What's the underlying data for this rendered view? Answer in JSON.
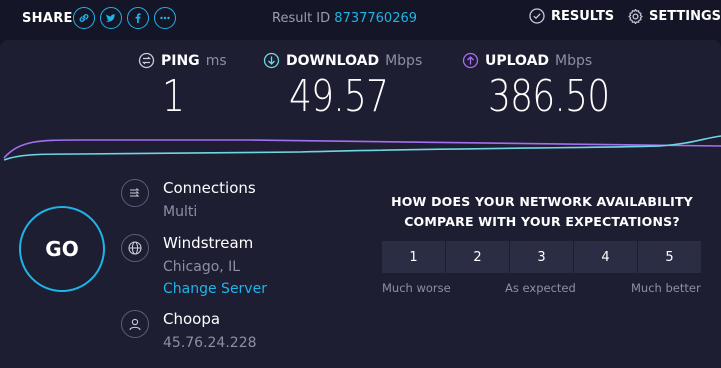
{
  "topbar": {
    "share_label": "SHARE",
    "share_icons": [
      "link-icon",
      "twitter-icon",
      "facebook-icon",
      "more-icon"
    ],
    "result_id_label": "Result ID",
    "result_id": "8737760269",
    "results_label": "RESULTS",
    "settings_label": "SETTINGS"
  },
  "metrics": {
    "ping": {
      "label": "PING",
      "unit": "ms",
      "value": "1"
    },
    "download": {
      "label": "DOWNLOAD",
      "unit": "Mbps",
      "value": "49.57"
    },
    "upload": {
      "label": "UPLOAD",
      "unit": "Mbps",
      "value": "386.50"
    }
  },
  "go_label": "GO",
  "connections": {
    "title": "Connections",
    "value": "Multi"
  },
  "host": {
    "title": "Windstream",
    "location": "Chicago, IL",
    "change_label": "Change Server"
  },
  "provider": {
    "title": "Choopa",
    "ip": "45.76.24.228"
  },
  "survey": {
    "question": "HOW DOES YOUR NETWORK AVAILABILITY COMPARE WITH YOUR EXPECTATIONS?",
    "options": [
      "1",
      "2",
      "3",
      "4",
      "5"
    ],
    "low_label": "Much worse",
    "mid_label": "As expected",
    "high_label": "Much better"
  },
  "colors": {
    "accent": "#1fb4e8",
    "download_line": "#6fd7e3",
    "upload_line": "#a56ff0",
    "background": "#141526",
    "panel": "#1d1e32"
  }
}
